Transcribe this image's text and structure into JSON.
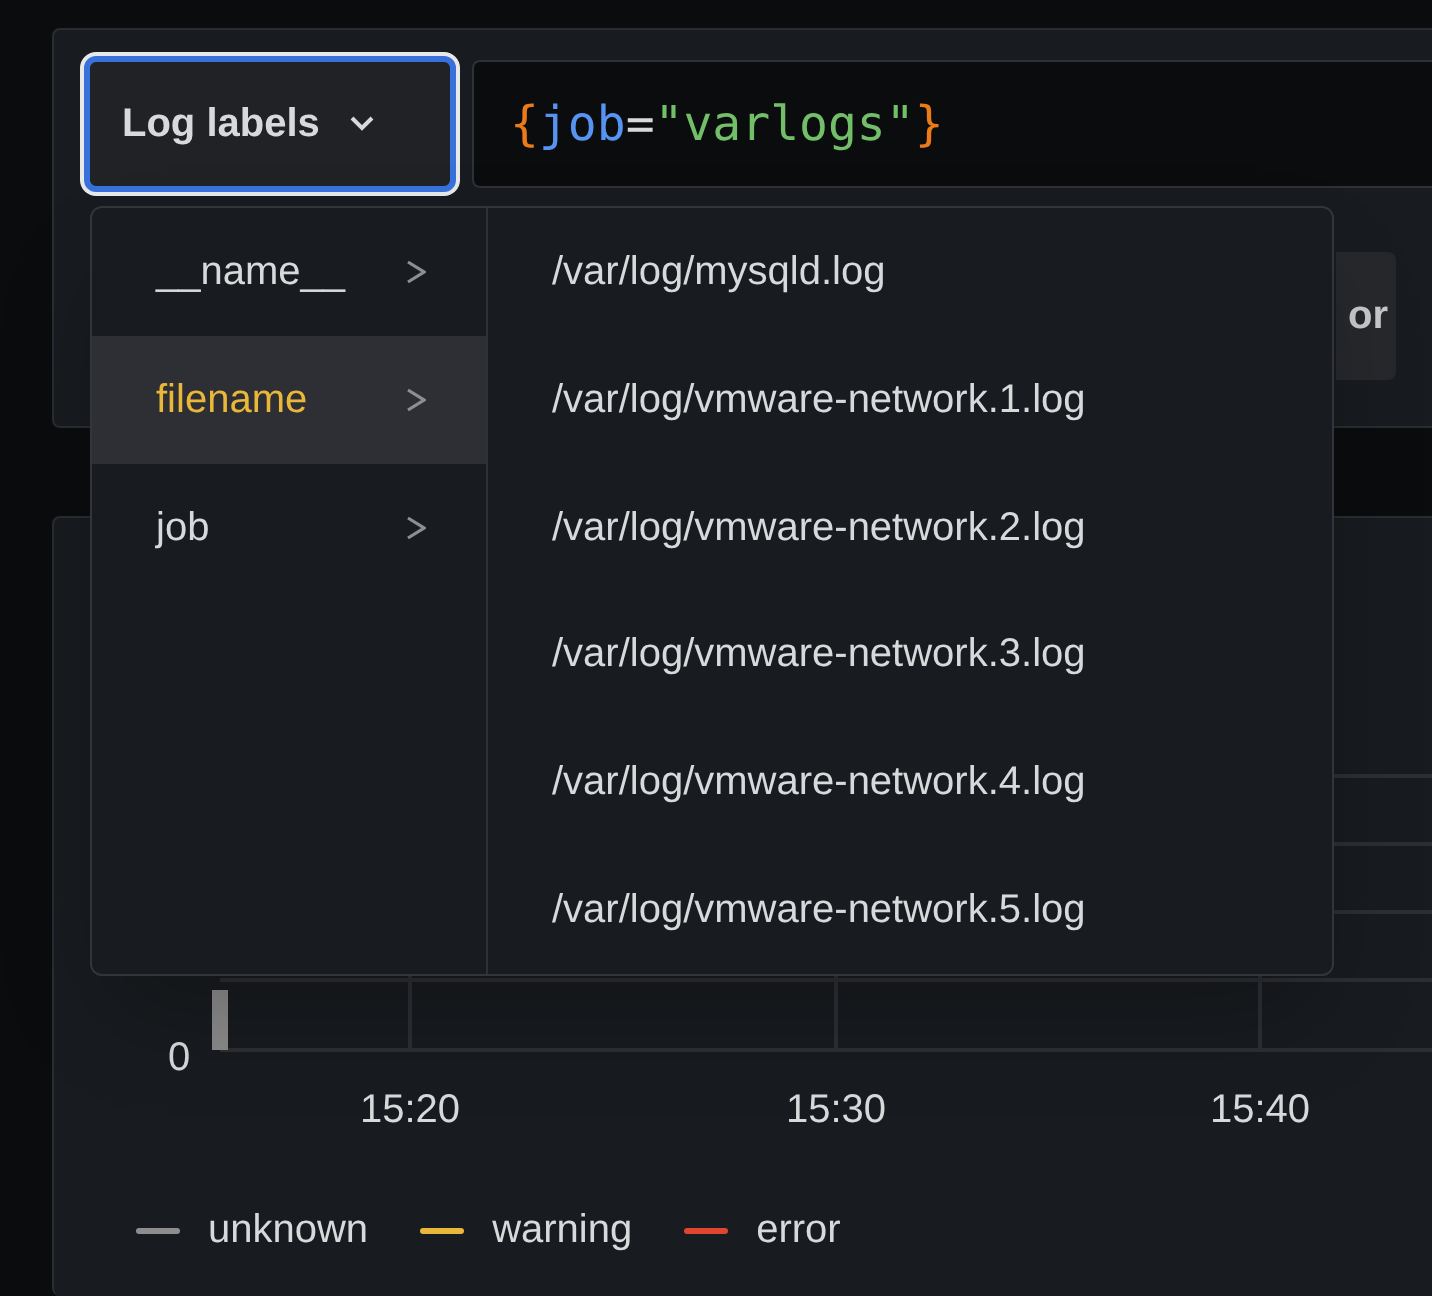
{
  "query_editor": {
    "label_browser_button": "Log labels",
    "query_tokens": [
      {
        "text": "{",
        "kind": "brace"
      },
      {
        "text": "job",
        "kind": "label"
      },
      {
        "text": "=",
        "kind": "operator"
      },
      {
        "text": "\"varlogs\"",
        "kind": "string"
      },
      {
        "text": "}",
        "kind": "brace"
      }
    ],
    "side_button": "or"
  },
  "label_menu": {
    "labels": [
      {
        "text": "__name__",
        "selected": false
      },
      {
        "text": "filename",
        "selected": true
      },
      {
        "text": "job",
        "selected": false
      }
    ],
    "values": [
      "/var/log/mysqld.log",
      "/var/log/vmware-network.1.log",
      "/var/log/vmware-network.2.log",
      "/var/log/vmware-network.3.log",
      "/var/log/vmware-network.4.log",
      "/var/log/vmware-network.5.log"
    ]
  },
  "graph": {
    "y_ticks": [
      "0"
    ],
    "x_ticks": [
      "15:20",
      "15:30",
      "15:40"
    ],
    "legend": [
      {
        "text": "unknown",
        "color": "#8e8e8e"
      },
      {
        "text": "warning",
        "color": "#eab839"
      },
      {
        "text": "error",
        "color": "#e0452f"
      }
    ]
  }
}
